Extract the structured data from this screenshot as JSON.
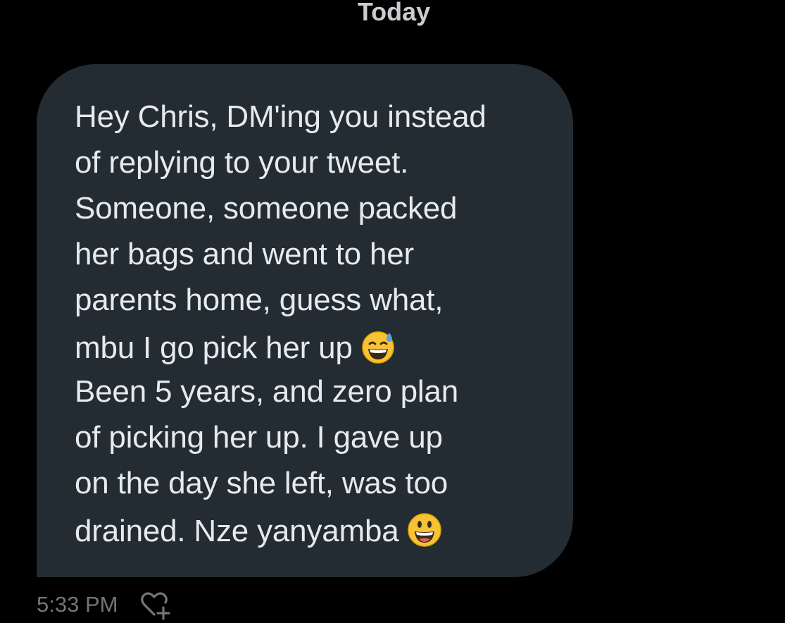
{
  "divider": {
    "label": "Today"
  },
  "message": {
    "lines": [
      "Hey Chris, DM'ing you instead",
      "of replying to your tweet.",
      "Someone, someone packed",
      "her bags and went to her",
      "parents home, guess what,",
      "mbu I go pick her up",
      "Been 5 years, and zero plan",
      "of picking her up. I gave up",
      "on the day she left, was too",
      "drained. Nze yanyamba"
    ],
    "emojis": {
      "line6": "grinning-face-with-sweat-icon",
      "line10": "grinning-face-icon"
    },
    "timestamp": "5:33 PM"
  },
  "icons": {
    "react": "heart-plus-icon"
  },
  "colors": {
    "background": "#000000",
    "bubble": "#232c33",
    "text": "#e7e9ea",
    "muted": "#71767b"
  }
}
